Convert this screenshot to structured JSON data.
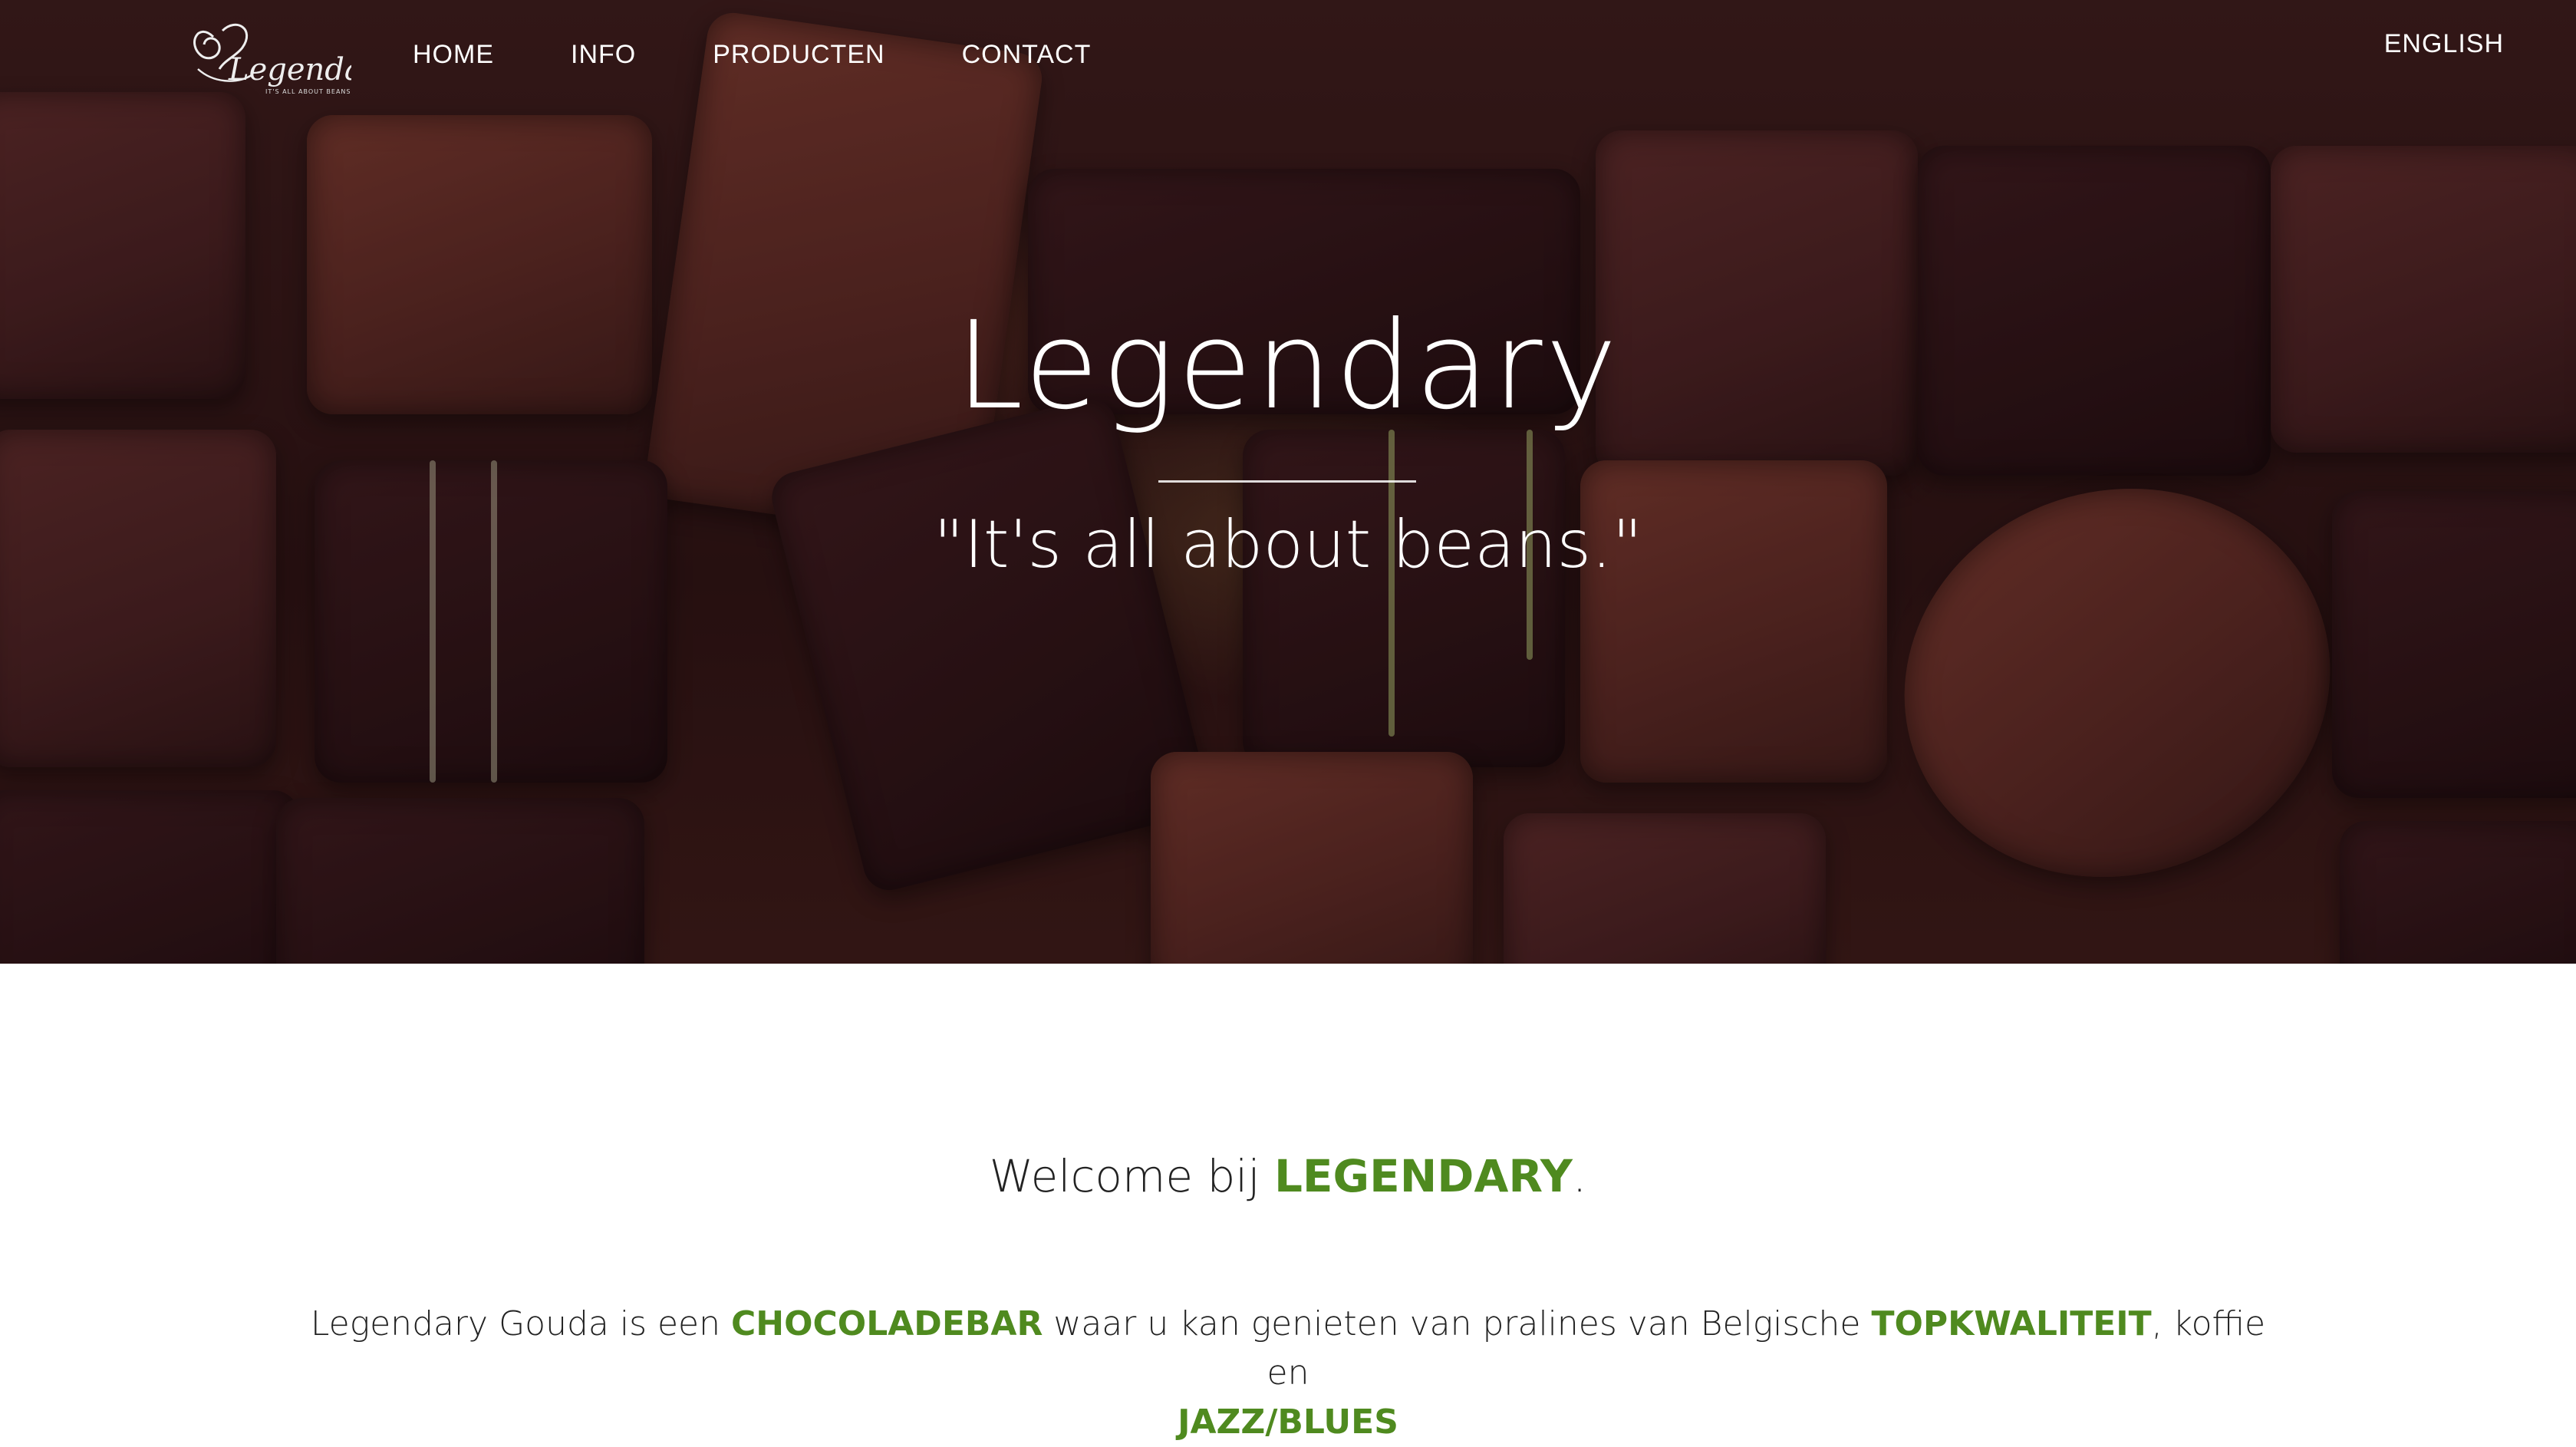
{
  "nav": {
    "logo_text": "Legendary",
    "logo_tagline": "IT'S ALL ABOUT BEANS",
    "links": [
      {
        "label": "HOME"
      },
      {
        "label": "INFO"
      },
      {
        "label": "PRODUCTEN"
      },
      {
        "label": "CONTACT"
      }
    ],
    "language_label": "ENGLISH"
  },
  "hero": {
    "title": "Legendary",
    "tagline": "\"It's all about beans.\""
  },
  "welcome": {
    "prefix": "Welcome bij ",
    "brand": "LEGENDARY",
    "suffix": "."
  },
  "intro": {
    "part1": "Legendary Gouda is een ",
    "highlight1": "CHOCOLADEBAR",
    "part2": " waar u kan genieten van pralines van Belgische ",
    "highlight2": "TOPKWALITEIT",
    "part3": ", koffie en ",
    "highlight3": "JAZZ/BLUES"
  },
  "colors": {
    "accent": "#4f8a1f",
    "text": "#222222",
    "hero_bg": "#2c1414"
  },
  "icons": {
    "logo": "legendary-swirl-logo"
  }
}
